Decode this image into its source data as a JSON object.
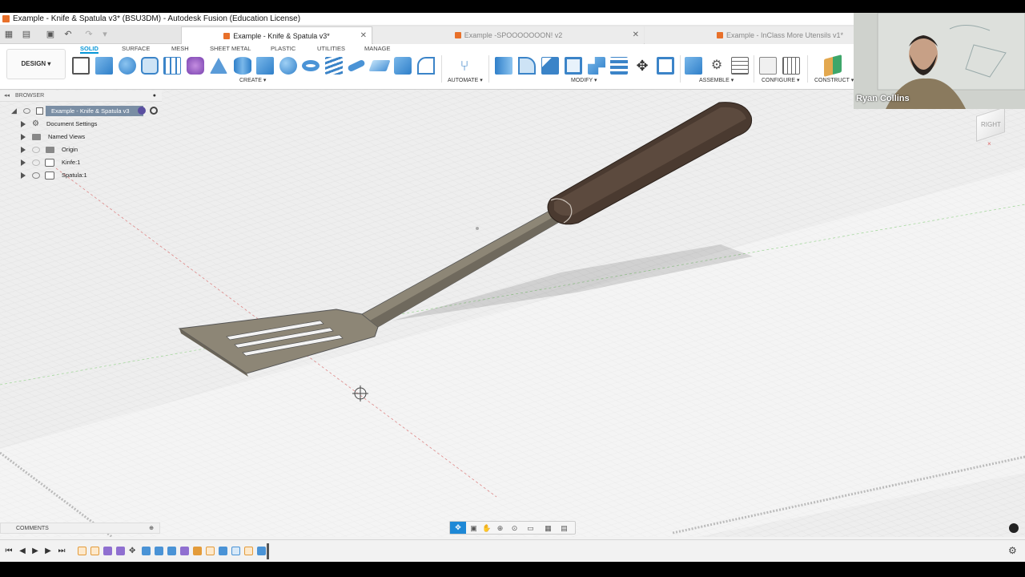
{
  "window": {
    "title": "Example - Knife & Spatula v3* (BSU3DM) - Autodesk Fusion (Education License)"
  },
  "tabs": [
    {
      "label": "Example - Knife & Spatula v3*",
      "active": true
    },
    {
      "label": "Example -SPOOOOOOON! v2",
      "active": false
    },
    {
      "label": "Example - InClass More Utensils v1*",
      "active": false
    }
  ],
  "workspace": {
    "label": "DESIGN"
  },
  "ribbon_tabs": [
    "SOLID",
    "SURFACE",
    "MESH",
    "SHEET METAL",
    "PLASTIC",
    "UTILITIES",
    "MANAGE"
  ],
  "ribbon_groups": {
    "create": "CREATE",
    "automate": "AUTOMATE",
    "modify": "MODIFY",
    "assemble": "ASSEMBLE",
    "configure": "CONFIGURE",
    "construct": "CONSTRUCT"
  },
  "browser": {
    "title": "BROWSER",
    "root": "Example - Knife & Spatula v3",
    "items": [
      {
        "label": "Document Settings",
        "icon": "gear-icon"
      },
      {
        "label": "Named Views",
        "icon": "folder-icon"
      },
      {
        "label": "Origin",
        "icon": "folder-icon"
      },
      {
        "label": "Kinfe:1",
        "icon": "component-icon"
      },
      {
        "label": "Spatula:1",
        "icon": "component-icon"
      }
    ]
  },
  "comments": {
    "label": "COMMENTS"
  },
  "viewcube": {
    "face": "RIGHT"
  },
  "webcam": {
    "name": "Ryan Collins"
  },
  "colors": {
    "accent": "#0696d7",
    "handle": "#4a3a30",
    "blade": "#8d8676"
  }
}
